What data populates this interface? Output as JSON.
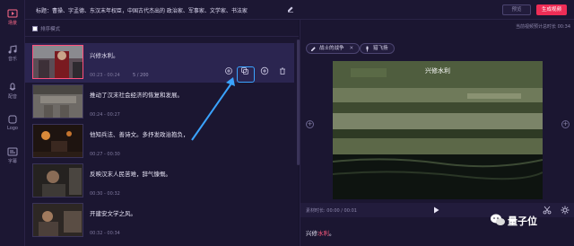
{
  "sidebar": {
    "items": [
      {
        "label": "场景",
        "icon": "scene-icon",
        "active": true
      },
      {
        "label": "音乐",
        "icon": "music-icon",
        "active": false
      },
      {
        "label": "配音",
        "icon": "dubbing-icon",
        "active": false
      },
      {
        "label": "Logo",
        "icon": "logo-icon",
        "active": false
      },
      {
        "label": "字幕",
        "icon": "subtitle-icon",
        "active": false
      }
    ]
  },
  "header": {
    "title": "标题：曹操、字孟德、东汉末年权臣，中国古代杰出的 政治家、军事家、文学家、书法家",
    "preview_label": "预览",
    "generate_label": "生成视频"
  },
  "list": {
    "sort_label": "排序模式",
    "scenes": [
      {
        "text": "兴修水利。",
        "time": "00:23 - 00:24",
        "count": "5 / 200",
        "active": true
      },
      {
        "text": "推动了汉末社会经济的恢复和发展。",
        "time": "00:24 - 00:27",
        "count": "",
        "active": false
      },
      {
        "text": "他知兵法、善诗文。多抒发政治抱负，",
        "time": "00:27 - 00:30",
        "count": "",
        "active": false
      },
      {
        "text": "反映汉末人民苦难，辞气慷慨。",
        "time": "00:30 - 00:32",
        "count": "",
        "active": false
      },
      {
        "text": "开建安文学之风。",
        "time": "00:32 - 00:34",
        "count": "",
        "active": false
      }
    ]
  },
  "preview": {
    "duration_note": "当前视频预计总时长 00:34",
    "tags": [
      {
        "label": "战士的战争",
        "icon": "edit-icon",
        "closable": true
      },
      {
        "label": "猎飞扬",
        "icon": "microphone-icon",
        "closable": false
      }
    ],
    "caption": "兴修水利",
    "material_time": "素材时长: 00:00 / 00:01",
    "subtitle_prefix": "兴修",
    "subtitle_highlight": "水利",
    "subtitle_suffix": "。"
  },
  "watermark": {
    "text": "量子位"
  },
  "colors": {
    "accent": "#ee2d56",
    "highlight": "#3aa3ff",
    "bg": "#16122a"
  }
}
